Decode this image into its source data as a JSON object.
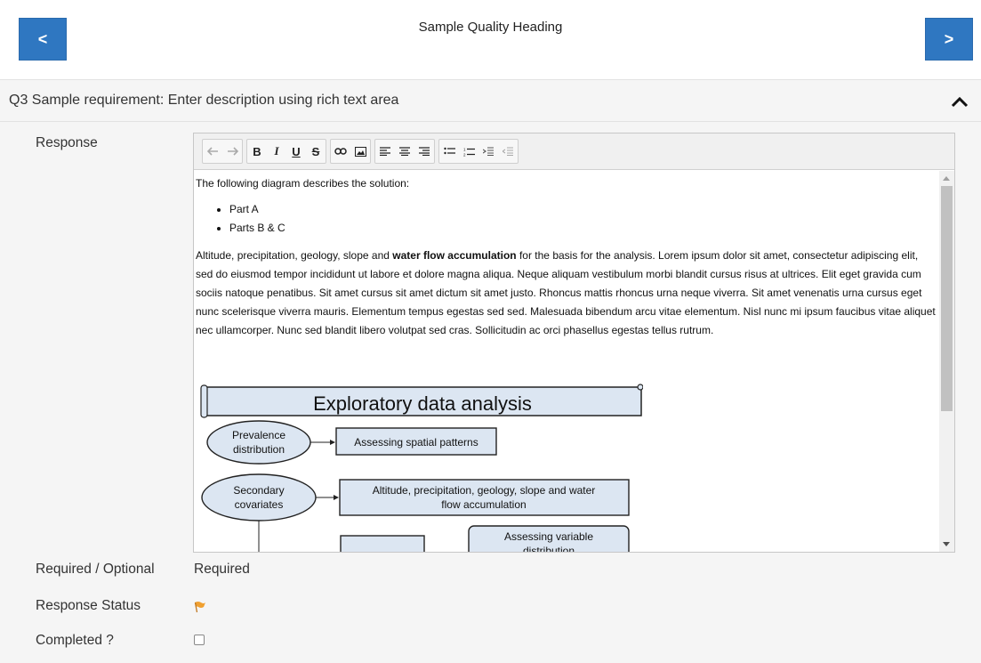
{
  "nav": {
    "prev_label": "<",
    "next_label": ">",
    "heading": "Sample Quality Heading"
  },
  "question": {
    "title": "Q3 Sample requirement: Enter description using rich text area",
    "collapse_icon": "chevron-up-icon"
  },
  "response": {
    "label": "Response",
    "toolbar": {
      "groups": [
        [
          "undo-icon",
          "redo-icon"
        ],
        [
          "bold-icon",
          "italic-icon",
          "underline-icon",
          "strikethrough-icon"
        ],
        [
          "link-icon",
          "image-icon"
        ],
        [
          "align-left-icon",
          "align-center-icon",
          "align-right-icon"
        ],
        [
          "bullet-list-icon",
          "numbered-list-icon",
          "indent-icon",
          "outdent-icon"
        ]
      ]
    },
    "content": {
      "intro": "The following diagram describes the solution:",
      "bullets": [
        "Part A",
        "Parts B & C"
      ],
      "para_start": "Altitude, precipitation, geology, slope and ",
      "para_bold": "water flow accumulation",
      "para_rest": " for the basis for the analysis. Lorem ipsum dolor sit amet, consectetur adipiscing elit, sed do eiusmod tempor incididunt ut labore et dolore magna aliqua. Neque aliquam vestibulum morbi blandit cursus risus at ultrices. Elit eget gravida cum sociis natoque penatibus. Sit amet cursus sit amet dictum sit amet justo. Rhoncus mattis rhoncus urna neque viverra. Sit amet venenatis urna cursus eget nunc scelerisque viverra mauris. Elementum tempus egestas sed sed. Malesuada bibendum arcu vitae elementum. Nisl nunc mi ipsum faucibus vitae aliquet nec ullamcorper. Nunc sed blandit libero volutpat sed cras. Sollicitudin ac orci phasellus egestas tellus rutrum."
    },
    "diagram": {
      "title": "Exploratory data analysis",
      "node1_line1": "Prevalence",
      "node1_line2": "distribution",
      "box1": "Assessing spatial patterns",
      "node2_line1": "Secondary",
      "node2_line2": "covariates",
      "box2_line1": "Altitude, precipitation, geology, slope and water",
      "box2_line2": "flow accumulation",
      "box3_line1": "Assessing variable",
      "box3_line2": "distribution"
    }
  },
  "required": {
    "label": "Required / Optional",
    "value": "Required"
  },
  "status": {
    "label": "Response Status",
    "flag_color": "#f0a030"
  },
  "completed": {
    "label": "Completed ?",
    "checked": false
  },
  "colors": {
    "nav_button": "#2f77c1",
    "section_bg": "#f5f5f5",
    "diagram_fill": "#dce6f2"
  }
}
